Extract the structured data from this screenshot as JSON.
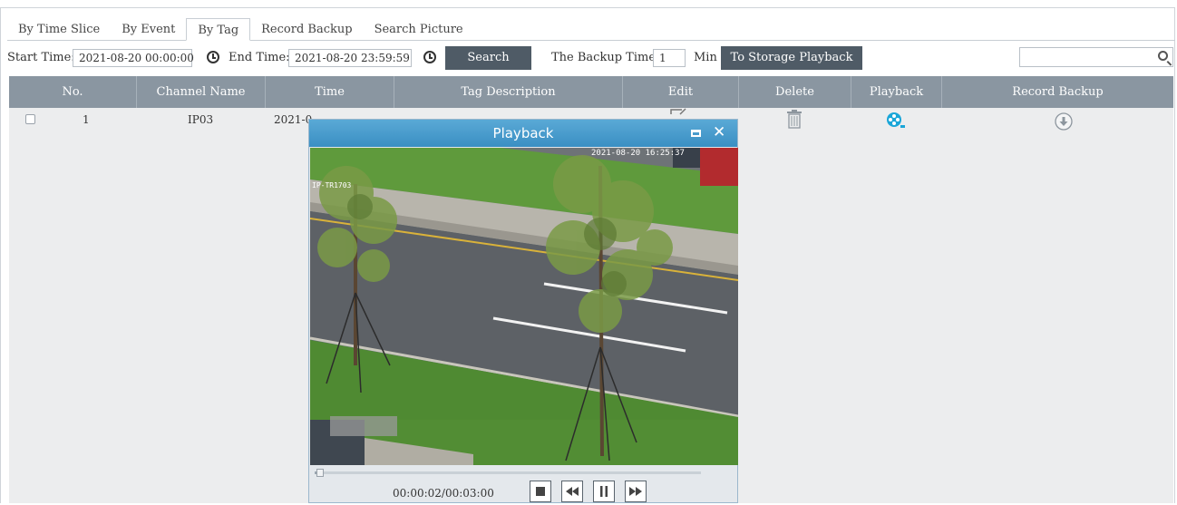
{
  "tabs": [
    "By Time Slice",
    "By Event",
    "By Tag",
    "Record Backup",
    "Search Picture"
  ],
  "active_tab": "By Tag",
  "toolbar": {
    "start_label": "Start Time:",
    "start_value": "2021-08-20 00:00:00",
    "end_label": "End Time:",
    "end_value": "2021-08-20 23:59:59",
    "search_label": "Search",
    "backup_label": "The Backup Time:",
    "backup_value": "1",
    "backup_unit": "Min",
    "storage_label": "To Storage Playback",
    "search_placeholder": ""
  },
  "table": {
    "columns": [
      "No.",
      "Channel Name",
      "Time",
      "Tag Description",
      "Edit",
      "Delete",
      "Playback",
      "Record Backup"
    ],
    "rows": [
      {
        "no": "1",
        "channel": "IP03",
        "time": "2021-0",
        "tag": ""
      }
    ]
  },
  "popup": {
    "title": "Playback",
    "video_timestamp": "2021-08-20 16:25:37",
    "video_label": "IP-TR1703",
    "time": "00:00:02/00:03:00",
    "progress": 0.02
  },
  "colors": {
    "header_bg": "#8a96a1",
    "button_bg": "#4f5b66",
    "popup_title": "#3a8fc3",
    "playback_icon": "#1aa6d8"
  },
  "icons": {
    "clock": "clock-icon",
    "search": "search-icon",
    "edit": "edit-icon",
    "delete": "trash-icon",
    "playback": "film-reel-icon",
    "backup": "download-icon"
  }
}
